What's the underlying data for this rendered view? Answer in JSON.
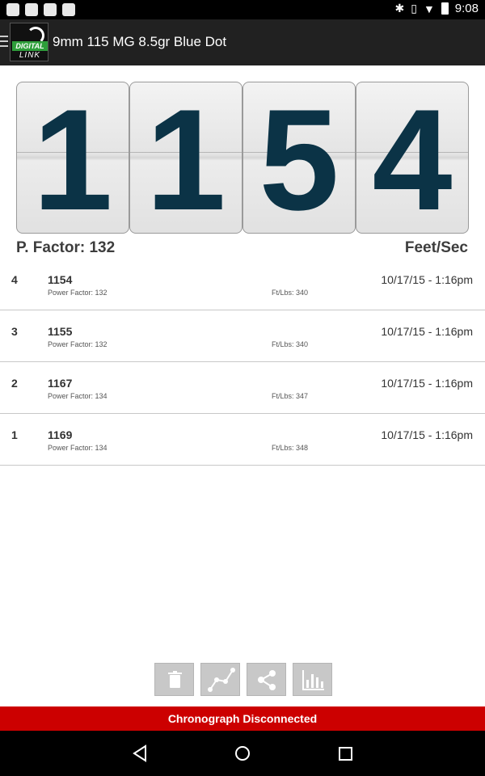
{
  "status_bar": {
    "time": "9:08",
    "icons": [
      "cloud-upload-icon",
      "image-icon",
      "mail-icon",
      "bag-icon",
      "bluetooth-icon",
      "vibrate-icon",
      "wifi-icon",
      "battery-icon"
    ]
  },
  "app_bar": {
    "title": "9mm 115 MG 8.5gr Blue Dot",
    "logo_text_top": "DIGITAL",
    "logo_text_bottom": "LINK"
  },
  "counter": {
    "digits": [
      "1",
      "1",
      "5",
      "4"
    ],
    "power_factor_label": "P. Factor: 132",
    "unit_label": "Feet/Sec"
  },
  "shots": [
    {
      "index": "4",
      "velocity": "1154",
      "power_factor": "Power Factor: 132",
      "ft_lbs": "Ft/Lbs: 340",
      "timestamp": "10/17/15 - 1:16pm"
    },
    {
      "index": "3",
      "velocity": "1155",
      "power_factor": "Power Factor: 132",
      "ft_lbs": "Ft/Lbs: 340",
      "timestamp": "10/17/15 - 1:16pm"
    },
    {
      "index": "2",
      "velocity": "1167",
      "power_factor": "Power Factor: 134",
      "ft_lbs": "Ft/Lbs: 347",
      "timestamp": "10/17/15 - 1:16pm"
    },
    {
      "index": "1",
      "velocity": "1169",
      "power_factor": "Power Factor: 134",
      "ft_lbs": "Ft/Lbs: 348",
      "timestamp": "10/17/15 - 1:16pm"
    }
  ],
  "toolbar": {
    "buttons": [
      "trash-icon",
      "trend-line-icon",
      "share-icon",
      "bar-chart-icon"
    ]
  },
  "connection_status": "Chronograph Disconnected",
  "colors": {
    "app_bar": "#212121",
    "digit_text": "#0b3346",
    "disconnect_bar": "#cc0000",
    "logo_green": "#2e9e3a"
  }
}
